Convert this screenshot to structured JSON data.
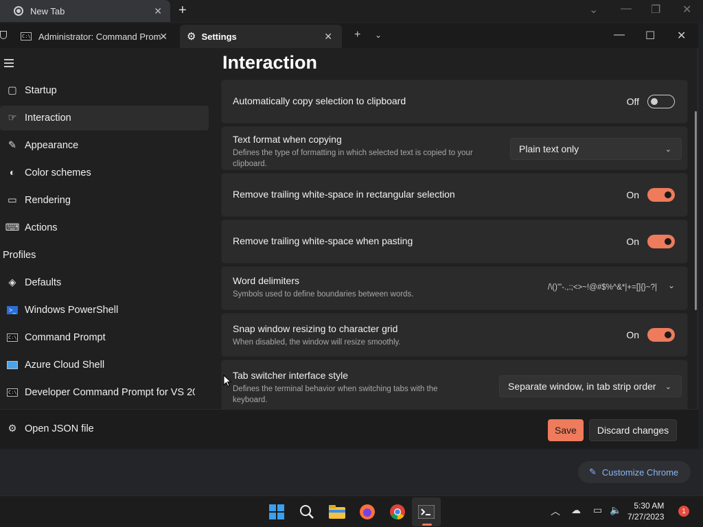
{
  "chrome": {
    "tab_title": "New Tab",
    "customize_label": "Customize Chrome"
  },
  "terminal": {
    "tabs": [
      {
        "label": "Administrator:  Command Prom",
        "icon": "cmd-icon"
      },
      {
        "label": "Settings",
        "icon": "gear-icon"
      }
    ]
  },
  "sidebar": {
    "items": [
      {
        "label": "Startup",
        "icon": "startup-icon"
      },
      {
        "label": "Interaction",
        "icon": "interaction-icon",
        "selected": true
      },
      {
        "label": "Appearance",
        "icon": "brush-icon"
      },
      {
        "label": "Color schemes",
        "icon": "palette-icon"
      },
      {
        "label": "Rendering",
        "icon": "monitor-icon"
      },
      {
        "label": "Actions",
        "icon": "keyboard-icon"
      }
    ],
    "profiles_heading": "Profiles",
    "profiles": [
      {
        "label": "Defaults",
        "icon": "layers-icon"
      },
      {
        "label": "Windows PowerShell",
        "icon": "powershell-icon"
      },
      {
        "label": "Command Prompt",
        "icon": "cmd-icon"
      },
      {
        "label": "Azure Cloud Shell",
        "icon": "azure-icon"
      },
      {
        "label": "Developer Command Prompt for VS 202",
        "icon": "cmd-icon"
      }
    ],
    "open_json": "Open JSON file"
  },
  "page": {
    "title": "Interaction",
    "settings": {
      "copy_on_select": {
        "label": "Automatically copy selection to clipboard",
        "state": "Off"
      },
      "text_format": {
        "label": "Text format when copying",
        "desc": "Defines the type of formatting in which selected text is copied to your clipboard.",
        "value": "Plain text only"
      },
      "trim_block": {
        "label": "Remove trailing white-space in rectangular selection",
        "state": "On"
      },
      "trim_paste": {
        "label": "Remove trailing white-space when pasting",
        "state": "On"
      },
      "word_delimiters": {
        "label": "Word delimiters",
        "desc": "Symbols used to define boundaries between words.",
        "value": "/\\()\"'-.,:;<>~!@#$%^&*|+=[]{}~?|"
      },
      "snap_resize": {
        "label": "Snap window resizing to character grid",
        "desc": "When disabled, the window will resize smoothly.",
        "state": "On"
      },
      "tab_switcher": {
        "label": "Tab switcher interface style",
        "desc": "Defines the terminal behavior when switching tabs with the keyboard.",
        "value": "Separate window, in tab strip order"
      }
    }
  },
  "actions": {
    "save": "Save",
    "discard": "Discard changes"
  },
  "taskbar": {
    "time": "5:30 AM",
    "date": "7/27/2023",
    "notifications": "1"
  },
  "colors": {
    "accent": "#ee7b5c",
    "background": "#202020",
    "card": "#2b2b2b"
  }
}
